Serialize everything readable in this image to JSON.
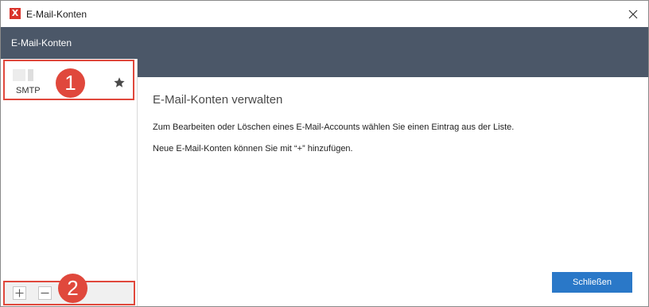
{
  "window": {
    "title": "E-Mail-Konten",
    "app_icon_glyph": "X",
    "close_icon": "close-icon"
  },
  "header": {
    "title": "E-Mail-Konten"
  },
  "sidebar": {
    "accounts": [
      {
        "type": "SMTP",
        "starred": true
      }
    ],
    "footer": {
      "add_label": "+",
      "remove_label": "−"
    }
  },
  "callouts": {
    "one": "1",
    "two": "2"
  },
  "main": {
    "heading": "E-Mail-Konten verwalten",
    "paragraph_1": "Zum Bearbeiten oder Löschen eines E-Mail-Accounts wählen Sie einen Eintrag aus der Liste.",
    "paragraph_2": "Neue E-Mail-Konten können Sie mit “+” hinzufügen.",
    "close_button_label": "Schließen"
  },
  "colors": {
    "header_bar": "#4b5768",
    "accent_button": "#2a78c8",
    "callout_red": "#e0483c",
    "app_icon_red": "#d9332b"
  }
}
